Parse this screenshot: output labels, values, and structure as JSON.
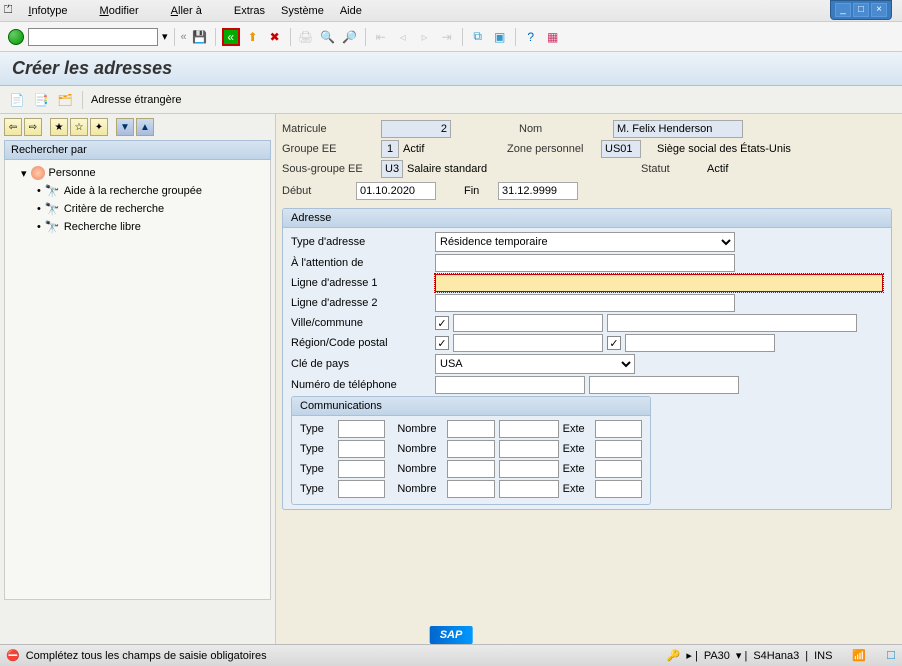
{
  "menu": {
    "doc": "⏍",
    "infotype": "Infotype",
    "modifier": "Modifier",
    "aller": "Aller à",
    "extras": "Extras",
    "systeme": "Système",
    "aide": "Aide"
  },
  "title": "Créer les adresses",
  "subtoolbar": {
    "foreign": "Adresse étrangère"
  },
  "sidebar": {
    "search_by": "Rechercher par",
    "person": "Personne",
    "items": [
      "Aide à la recherche groupée",
      "Critère de recherche",
      "Recherche libre"
    ]
  },
  "header": {
    "matricule_lbl": "Matricule",
    "matricule": "2",
    "nom_lbl": "Nom",
    "nom": "M. Felix Henderson",
    "grp_lbl": "Groupe EE",
    "grp": "1",
    "grp_txt": "Actif",
    "zone_lbl": "Zone personnel",
    "zone": "US01",
    "zone_txt": "Siège social des États-Unis",
    "sgrp_lbl": "Sous-groupe EE",
    "sgrp": "U3",
    "sgrp_txt": "Salaire standard",
    "statut_lbl": "Statut",
    "statut_txt": "Actif",
    "debut_lbl": "Début",
    "debut": "01.10.2020",
    "fin_lbl": "Fin",
    "fin": "31.12.9999"
  },
  "address": {
    "title": "Adresse",
    "type_lbl": "Type d'adresse",
    "type": "Résidence temporaire",
    "attn_lbl": "À l'attention de",
    "line1_lbl": "Ligne d'adresse 1",
    "line2_lbl": "Ligne d'adresse 2",
    "city_lbl": "Ville/commune",
    "region_lbl": "Région/Code postal",
    "country_lbl": "Clé de pays",
    "country": "USA",
    "phone_lbl": "Numéro de téléphone"
  },
  "comm": {
    "title": "Communications",
    "rows": [
      {
        "type_lbl": "Type",
        "num_lbl": "Nombre",
        "ext_lbl": "Exte"
      },
      {
        "type_lbl": "Type",
        "num_lbl": "Nombre",
        "ext_lbl": "Exte"
      },
      {
        "type_lbl": "Type",
        "num_lbl": "Nombre",
        "ext_lbl": "Exte"
      },
      {
        "type_lbl": "Type",
        "num_lbl": "Nombre",
        "ext_lbl": "Exte"
      }
    ]
  },
  "status": {
    "msg": "Complétez tous les champs de saisie obligatoires",
    "tcode": "PA30",
    "system": "S4Hana3",
    "mode": "INS"
  },
  "sap": "SAP"
}
